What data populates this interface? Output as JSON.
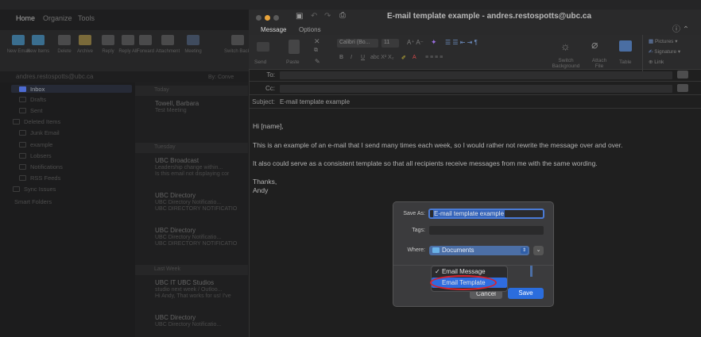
{
  "main": {
    "tabs": [
      "Home",
      "Organize",
      "Tools"
    ],
    "ribbon": [
      {
        "label": "New Email",
        "icon": "new-email-icon"
      },
      {
        "label": "New Items",
        "icon": "new-items-icon"
      },
      {
        "label": "Delete",
        "icon": "delete-icon"
      },
      {
        "label": "Archive",
        "icon": "archive-icon"
      },
      {
        "label": "Reply",
        "icon": "reply-icon"
      },
      {
        "label": "Reply All",
        "icon": "reply-all-icon"
      },
      {
        "label": "Forward",
        "icon": "forward-icon"
      },
      {
        "label": "Attachment",
        "icon": "attachment-icon"
      },
      {
        "label": "Meeting",
        "icon": "meeting-icon"
      },
      {
        "label": "Switch Backgro",
        "icon": "switch-background-icon"
      }
    ],
    "account": "andres.restospotts@ubc.ca",
    "sort_label": "By: Conve"
  },
  "sidebar": {
    "folders": [
      {
        "label": "Inbox",
        "icon": "inbox-icon",
        "selected": true
      },
      {
        "label": "Drafts",
        "icon": "drafts-icon"
      },
      {
        "label": "Sent",
        "icon": "sent-icon"
      },
      {
        "label": "Deleted Items",
        "icon": "trash-icon"
      },
      {
        "label": "Junk Email",
        "icon": "junk-icon"
      },
      {
        "label": "example",
        "icon": "folder-icon"
      },
      {
        "label": "Lobsers",
        "icon": "folder-icon"
      },
      {
        "label": "Notifications",
        "icon": "folder-icon"
      },
      {
        "label": "RSS Feeds",
        "icon": "rss-icon"
      },
      {
        "label": "Sync Issues",
        "icon": "folder-icon"
      },
      {
        "label": "Smart Folders",
        "icon": "smart-folder-icon"
      }
    ]
  },
  "message_list": {
    "groups": [
      {
        "header": "Today",
        "items": [
          {
            "sender": "Towell, Barbara",
            "subject": "Test Meeting",
            "preview": ""
          }
        ]
      },
      {
        "header": "Tuesday",
        "items": [
          {
            "sender": "UBC Broadcast",
            "subject": "Leadership change within...",
            "preview": "Is this email not displaying cor"
          },
          {
            "sender": "UBC Directory",
            "subject": "UBC Directory Notificatio...",
            "preview": "UBC DIRECTORY NOTIFICATIO"
          },
          {
            "sender": "UBC Directory",
            "subject": "UBC Directory Notificatio...",
            "preview": "UBC DIRECTORY NOTIFICATIO"
          }
        ]
      },
      {
        "header": "Last Week",
        "items": [
          {
            "sender": "UBC IT UBC Studios",
            "subject": "studio next week / Outloo...",
            "preview": "Hi Andy, That works for us! I've"
          },
          {
            "sender": "UBC Directory",
            "subject": "UBC Directory Notificatio...",
            "preview": ""
          }
        ]
      }
    ]
  },
  "compose": {
    "title": "E-mail template example - andres.restospotts@ubc.ca",
    "tabs": [
      "Message",
      "Options"
    ],
    "ribbon": {
      "send": "Send",
      "paste": "Paste",
      "font": "Calibri (Bo...",
      "size": "11",
      "switch_background": "Switch Background",
      "attach_file": "Attach File",
      "table": "Table",
      "pictures": "Pictures",
      "signature": "Signature",
      "link": "Link"
    },
    "to_label": "To:",
    "cc_label": "Cc:",
    "subject_label": "Subject:",
    "subject_value": "E-mail template example",
    "body": [
      "Hi [name],",
      "This is an example of an e-mail that I send many times each week, so I would rather not rewrite the message over and over.",
      "It also could serve as a consistent template so that all recipients receive messages from me with the same wording.",
      "Thanks,",
      "Andy"
    ]
  },
  "dialog": {
    "save_as_label": "Save As:",
    "save_as_value": "E-mail template example",
    "tags_label": "Tags:",
    "where_label": "Where:",
    "where_value": "Documents",
    "format_options": [
      {
        "label": "Email Message",
        "checked": true
      },
      {
        "label": "Email Template",
        "checked": false,
        "highlighted": true
      }
    ],
    "cancel": "Cancel",
    "save": "Save"
  },
  "colors": {
    "accent": "#2b6ddd",
    "annotation": "#d8232f"
  }
}
